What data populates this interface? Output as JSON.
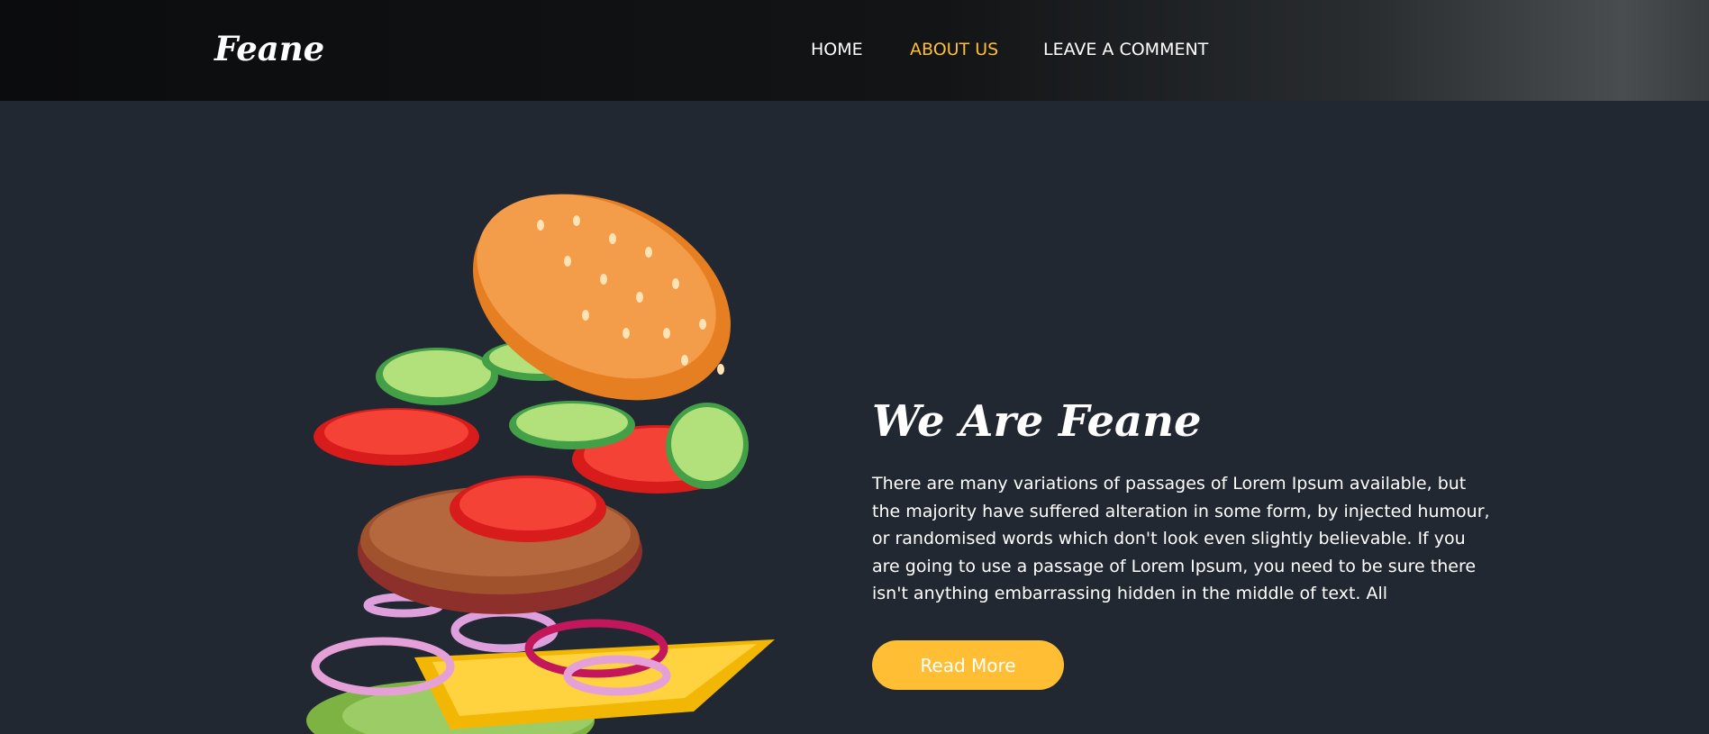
{
  "header": {
    "brand": "Feane",
    "nav": [
      {
        "label": "HOME",
        "active": false
      },
      {
        "label": "ABOUT US",
        "active": true
      },
      {
        "label": "LEAVE A COMMENT",
        "active": false
      }
    ]
  },
  "about": {
    "image_icon": "exploded-burger-illustration",
    "title": "We Are Feane",
    "text": "There are many variations of passages of Lorem Ipsum available, but the majority have suffered alteration in some form, by injected humour, or randomised words which don't look even slightly believable. If you are going to use a passage of Lorem Ipsum, you need to be sure there isn't anything embarrassing hidden in the middle of text. All",
    "button_label": "Read More"
  },
  "colors": {
    "background": "#222831",
    "header": "#0c0d0e",
    "accent": "#ffbe33",
    "text": "#ffffff"
  }
}
